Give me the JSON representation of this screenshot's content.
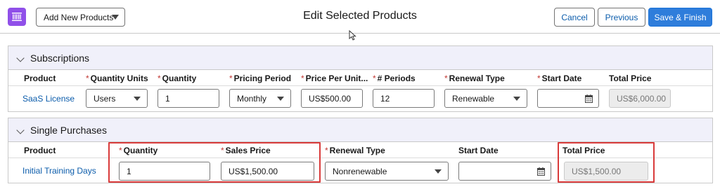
{
  "header": {
    "add_products_label": "Add New Products",
    "title": "Edit Selected Products",
    "cancel_label": "Cancel",
    "previous_label": "Previous",
    "save_label": "Save & Finish"
  },
  "subscriptions": {
    "title": "Subscriptions",
    "columns": {
      "product": "Product",
      "quantity_units": "Quantity Units",
      "quantity": "Quantity",
      "pricing_period": "Pricing Period",
      "price_per_unit": "Price Per Unit...",
      "periods": "# Periods",
      "renewal_type": "Renewal Type",
      "start_date": "Start Date",
      "total_price": "Total Price"
    },
    "row": {
      "product": "SaaS License",
      "quantity_units": "Users",
      "quantity": "1",
      "pricing_period": "Monthly",
      "price_per_unit": "US$500.00",
      "periods": "12",
      "renewal_type": "Renewable",
      "start_date": "",
      "total_price": "US$6,000.00"
    }
  },
  "single_purchases": {
    "title": "Single Purchases",
    "columns": {
      "product": "Product",
      "quantity": "Quantity",
      "sales_price": "Sales Price",
      "renewal_type": "Renewal Type",
      "start_date": "Start Date",
      "total_price": "Total Price"
    },
    "row": {
      "product": "Initial Training Days",
      "quantity": "1",
      "sales_price": "US$1,500.00",
      "renewal_type": "Nonrenewable",
      "start_date": "",
      "total_price": "US$1,500.00"
    }
  },
  "colors": {
    "accent": "#2e7ddb",
    "link": "#0b5cab",
    "required": "#c23934",
    "highlight": "#d93b3b",
    "app_icon": "#9050e9",
    "section_header_bg": "#f0f0fa"
  },
  "icons": [
    "barcode-icon",
    "chevron-down-icon",
    "calendar-icon",
    "cursor-icon"
  ]
}
